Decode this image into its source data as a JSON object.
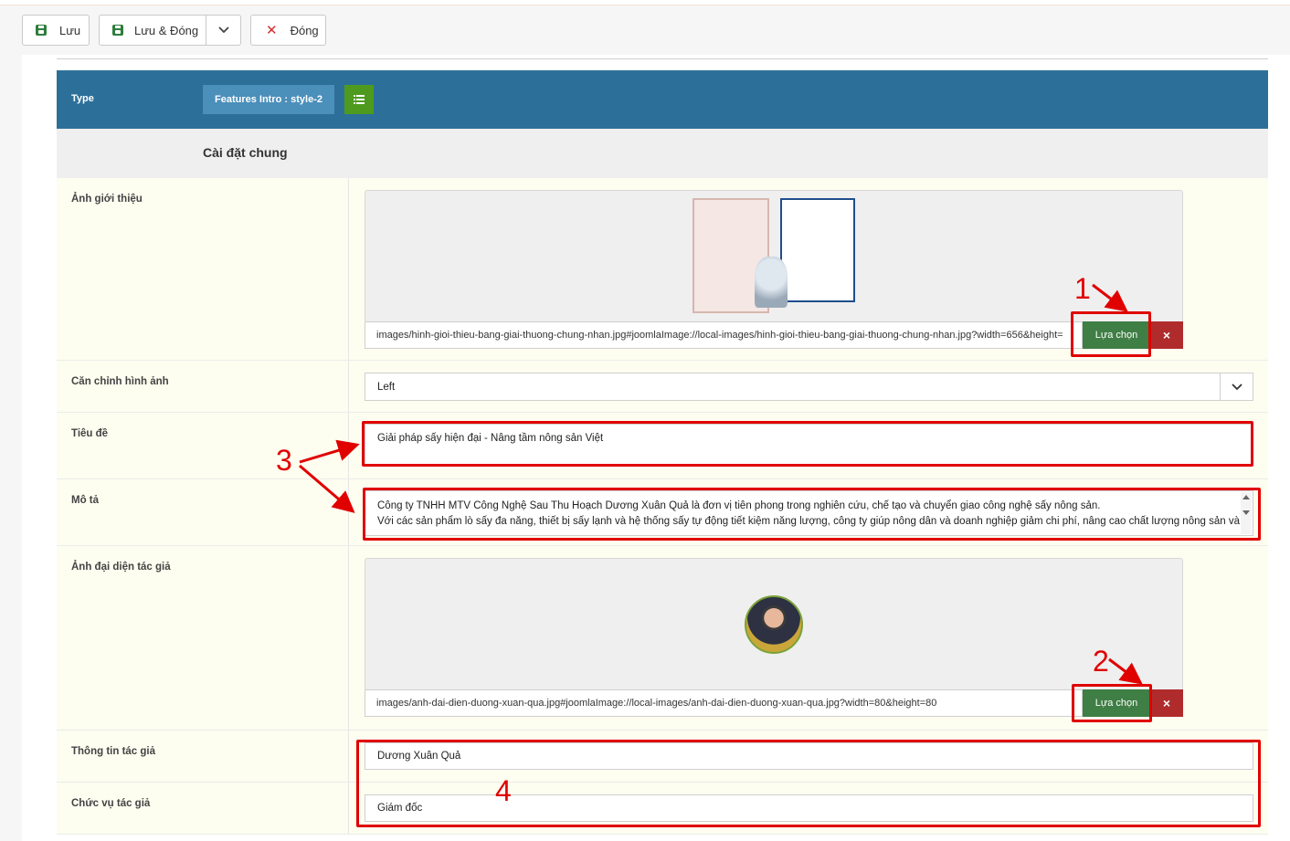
{
  "toolbar": {
    "save_label": "Lưu",
    "save_close_label": "Lưu & Đóng",
    "close_label": "Đóng"
  },
  "type_bar": {
    "label": "Type",
    "value": "Features Intro : style-2"
  },
  "section_title": "Cài đặt chung",
  "fields": {
    "intro_image": {
      "label": "Ảnh giới thiệu",
      "path": "images/hinh-gioi-thieu-bang-giai-thuong-chung-nhan.jpg#joomlaImage://local-images/hinh-gioi-thieu-bang-giai-thuong-chung-nhan.jpg?width=656&height=",
      "select_label": "Lựa chọn",
      "clear_label": "×"
    },
    "image_align": {
      "label": "Căn chỉnh hình ảnh",
      "value": "Left"
    },
    "title": {
      "label": "Tiêu đề",
      "value": "Giải pháp sấy hiện đại - Nâng tầm nông sản Việt"
    },
    "description": {
      "label": "Mô tả",
      "line1": "Công ty TNHH MTV Công Nghệ Sau Thu Hoạch Dương Xuân Quả là đơn vị tiên phong trong nghiên cứu, chế tạo và chuyển giao công nghệ sấy nông sản.",
      "line2": "Với các sản phẩm lò sấy đa năng, thiết bị sấy lạnh và hệ thống sấy tự động tiết kiệm năng lượng, công ty giúp nông dân và doanh nghiệp giảm chi phí, nâng cao chất lượng nông sản và"
    },
    "author_avatar": {
      "label": "Ảnh đại diện tác giả",
      "path": "images/anh-dai-dien-duong-xuan-qua.jpg#joomlaImage://local-images/anh-dai-dien-duong-xuan-qua.jpg?width=80&height=80",
      "select_label": "Lựa chọn",
      "clear_label": "×"
    },
    "author_info": {
      "label": "Thông tin tác giả",
      "value": "Dương Xuân Quả"
    },
    "author_position": {
      "label": "Chức vụ tác giả",
      "value": "Giám đốc"
    }
  },
  "annotations": [
    "1",
    "2",
    "3",
    "4"
  ],
  "colors": {
    "type_bar": "#2c7099",
    "select_button": "#3f7e45",
    "clear_button": "#b02c2c",
    "annotation_red": "#e00000",
    "row_background": "#fdfdf0"
  },
  "icons": [
    "save-icon",
    "chevron-down-icon",
    "close-icon",
    "list-icon",
    "trophy-icon"
  ]
}
